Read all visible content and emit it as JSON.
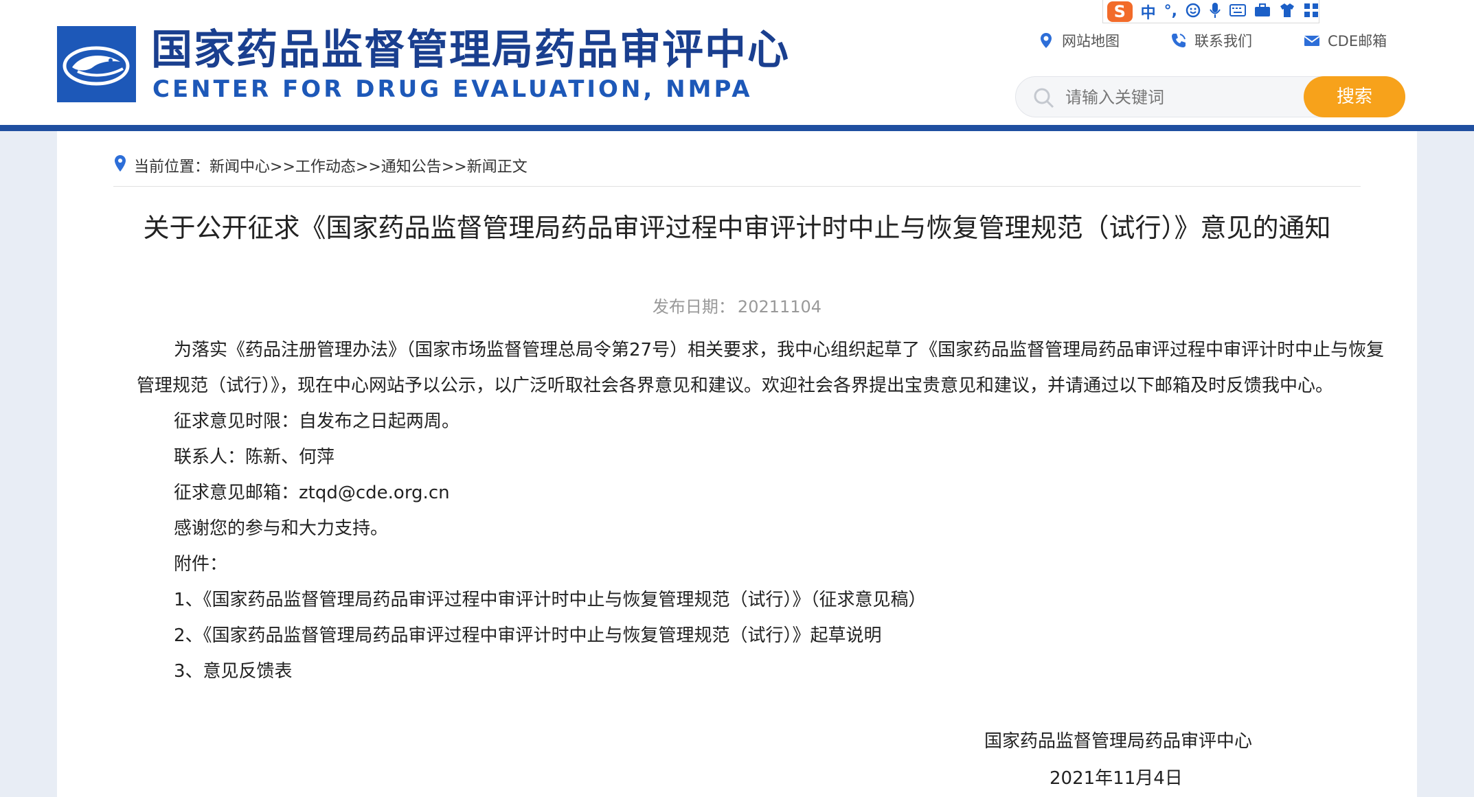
{
  "header": {
    "title_cn": "国家药品监督管理局药品审评中心",
    "title_en": "CENTER FOR DRUG EVALUATION, NMPA",
    "logo_icon": "cde-logo-icon",
    "brand_color": "#1d58b8",
    "links": [
      {
        "label": "网站地图",
        "icon": "map-pin-icon"
      },
      {
        "label": "联系我们",
        "icon": "phone-icon"
      },
      {
        "label": "CDE邮箱",
        "icon": "mail-icon"
      }
    ],
    "search": {
      "placeholder": "请输入关键词",
      "button_label": "搜索",
      "button_color": "#f7a21b"
    }
  },
  "ime": {
    "logo": "S",
    "mode": "中",
    "punct": "°,",
    "icons": [
      "smile-icon",
      "mic-icon",
      "keyboard-icon",
      "toolbox-icon",
      "shirt-icon",
      "grid-icon"
    ]
  },
  "breadcrumb": {
    "label": "当前位置：",
    "items": [
      "新闻中心",
      "工作动态",
      "通知公告",
      "新闻正文"
    ],
    "separator": ">>"
  },
  "article": {
    "title": "关于公开征求《国家药品监督管理局药品审评过程中审评计时中止与恢复管理规范（试行）》意见的通知",
    "date_label": "发布日期：",
    "date": "20211104",
    "paragraphs": [
      "为落实《药品注册管理办法》（国家市场监督管理总局令第27号）相关要求，我中心组织起草了《国家药品监督管理局药品审评过程中审评计时中止与恢复管理规范（试行）》，现在中心网站予以公示，以广泛听取社会各界意见和建议。欢迎社会各界提出宝贵意见和建议，并请通过以下邮箱及时反馈我中心。",
      "征求意见时限：自发布之日起两周。",
      "联系人：陈新、何萍",
      "征求意见邮箱：ztqd@cde.org.cn",
      "感谢您的参与和大力支持。",
      "附件："
    ],
    "attachments": [
      "1、《国家药品监督管理局药品审评过程中审评计时中止与恢复管理规范（试行）》（征求意见稿）",
      "2、《国家药品监督管理局药品审评过程中审评计时中止与恢复管理规范（试行）》起草说明",
      "3、意见反馈表"
    ],
    "signature": "国家药品监督管理局药品审评中心",
    "sign_date": "2021年11月4日"
  }
}
